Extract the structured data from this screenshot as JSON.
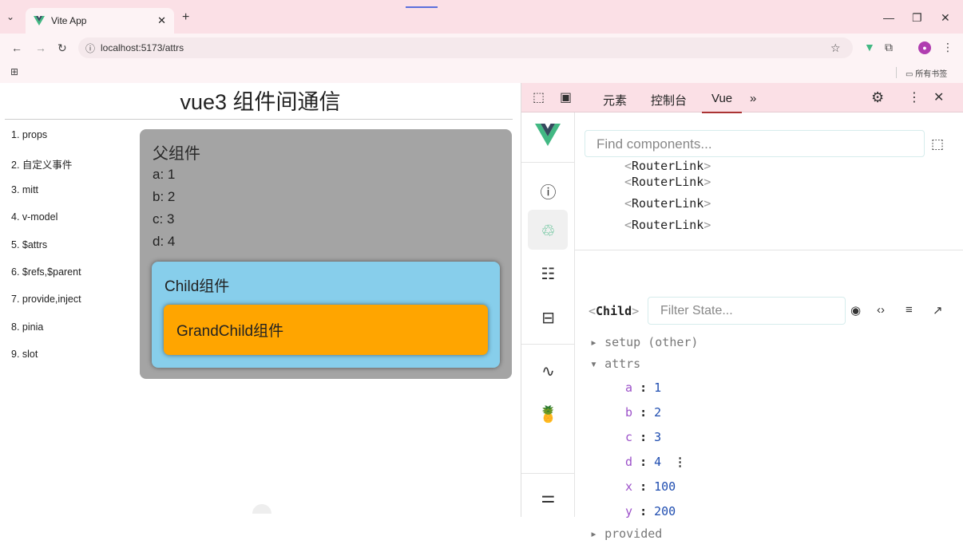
{
  "browser": {
    "tab_title": "Vite App",
    "url": "localhost:5173/attrs",
    "bookmarks_label": "所有书签"
  },
  "page": {
    "title": "vue3 组件间通信",
    "menu": [
      "1. props",
      "2. 自定义事件",
      "3. mitt",
      "4. v-model",
      "5. $attrs",
      "6. $refs,$parent",
      "7. provide,inject",
      "8. pinia",
      "9. slot"
    ],
    "parent": {
      "title": "父组件",
      "rows": [
        "a: 1",
        "b: 2",
        "c: 3",
        "d: 4"
      ],
      "child_title": "Child组件",
      "grandchild_title": "GrandChild组件"
    }
  },
  "devtools": {
    "tabs": [
      "元素",
      "控制台",
      "Vue"
    ],
    "active_tab": "Vue",
    "more": "»",
    "find_placeholder": "Find components...",
    "tree": [
      "RouterLink",
      "RouterLink",
      "RouterLink",
      "RouterLink"
    ],
    "selected_component": "Child",
    "filter_placeholder": "Filter State...",
    "sections": {
      "setup": "setup (other)",
      "attrs": "attrs",
      "provided": "provided"
    },
    "attrs": [
      {
        "key": "a",
        "value": "1"
      },
      {
        "key": "b",
        "value": "2"
      },
      {
        "key": "c",
        "value": "3"
      },
      {
        "key": "d",
        "value": "4"
      },
      {
        "key": "x",
        "value": "100"
      },
      {
        "key": "y",
        "value": "200"
      }
    ]
  },
  "colors": {
    "parent_bg": "#a4a4a4",
    "child_bg": "#87ceeb",
    "grandchild_bg": "#ffa500",
    "vue_green": "#42b883",
    "devtools_tab_bg": "#fbe0e6"
  }
}
